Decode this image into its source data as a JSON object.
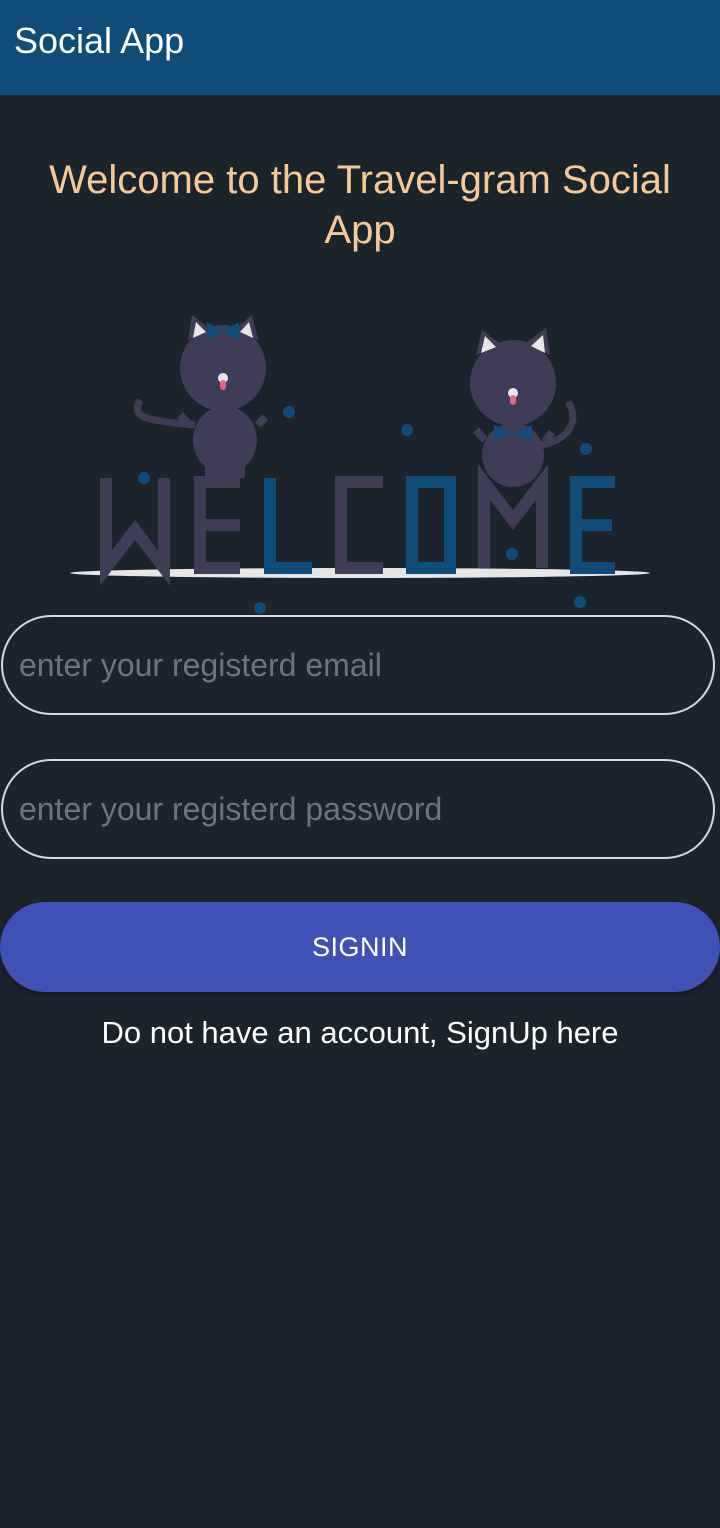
{
  "appbar": {
    "title": "Social App"
  },
  "main": {
    "welcome_heading": "Welcome to the Travel-gram Social App",
    "illustration": {
      "label": "WELCOME"
    },
    "email_placeholder": "enter your registerd email",
    "email_value": "",
    "password_placeholder": "enter your registerd password",
    "password_value": "",
    "signin_label": "SIGNIN",
    "signup_link": "Do not have an account, SignUp here"
  },
  "colors": {
    "appbar": "#0f4c79",
    "background": "#1b242b",
    "heading": "#f8c896",
    "button": "#3f51b5"
  }
}
